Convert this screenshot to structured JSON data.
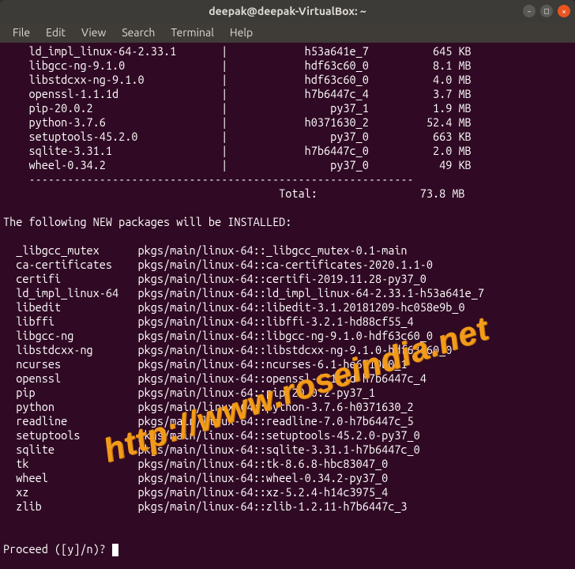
{
  "window": {
    "title": "deepak@deepak-VirtualBox: ~"
  },
  "menu": {
    "file": "File",
    "edit": "Edit",
    "view": "View",
    "search": "Search",
    "terminal": "Terminal",
    "help": "Help"
  },
  "dl_table": {
    "rows": [
      {
        "name": "ld_impl_linux-64-2.33.1",
        "build": "h53a641e_7",
        "size": "645 KB"
      },
      {
        "name": "libgcc-ng-9.1.0",
        "build": "hdf63c60_0",
        "size": "8.1 MB"
      },
      {
        "name": "libstdcxx-ng-9.1.0",
        "build": "hdf63c60_0",
        "size": "4.0 MB"
      },
      {
        "name": "openssl-1.1.1d",
        "build": "h7b6447c_4",
        "size": "3.7 MB"
      },
      {
        "name": "pip-20.0.2",
        "build": "py37_1",
        "size": "1.9 MB"
      },
      {
        "name": "python-3.7.6",
        "build": "h0371630_2",
        "size": "52.4 MB"
      },
      {
        "name": "setuptools-45.2.0",
        "build": "py37_0",
        "size": "663 KB"
      },
      {
        "name": "sqlite-3.31.1",
        "build": "h7b6447c_0",
        "size": "2.0 MB"
      },
      {
        "name": "wheel-0.34.2",
        "build": "py37_0",
        "size": "49 KB"
      }
    ],
    "sep": "    ------------------------------------------------------------",
    "total_label": "Total:",
    "total_value": "73.8 MB"
  },
  "install": {
    "heading": "The following NEW packages will be INSTALLED:",
    "rows": [
      {
        "name": "_libgcc_mutex",
        "spec": "pkgs/main/linux-64::_libgcc_mutex-0.1-main"
      },
      {
        "name": "ca-certificates",
        "spec": "pkgs/main/linux-64::ca-certificates-2020.1.1-0"
      },
      {
        "name": "certifi",
        "spec": "pkgs/main/linux-64::certifi-2019.11.28-py37_0"
      },
      {
        "name": "ld_impl_linux-64",
        "spec": "pkgs/main/linux-64::ld_impl_linux-64-2.33.1-h53a641e_7"
      },
      {
        "name": "libedit",
        "spec": "pkgs/main/linux-64::libedit-3.1.20181209-hc058e9b_0"
      },
      {
        "name": "libffi",
        "spec": "pkgs/main/linux-64::libffi-3.2.1-hd88cf55_4"
      },
      {
        "name": "libgcc-ng",
        "spec": "pkgs/main/linux-64::libgcc-ng-9.1.0-hdf63c60_0"
      },
      {
        "name": "libstdcxx-ng",
        "spec": "pkgs/main/linux-64::libstdcxx-ng-9.1.0-hdf63c60_0"
      },
      {
        "name": "ncurses",
        "spec": "pkgs/main/linux-64::ncurses-6.1-he6710b0_1"
      },
      {
        "name": "openssl",
        "spec": "pkgs/main/linux-64::openssl-1.1.1d-h7b6447c_4"
      },
      {
        "name": "pip",
        "spec": "pkgs/main/linux-64::pip-20.0.2-py37_1"
      },
      {
        "name": "python",
        "spec": "pkgs/main/linux-64::python-3.7.6-h0371630_2"
      },
      {
        "name": "readline",
        "spec": "pkgs/main/linux-64::readline-7.0-h7b6447c_5"
      },
      {
        "name": "setuptools",
        "spec": "pkgs/main/linux-64::setuptools-45.2.0-py37_0"
      },
      {
        "name": "sqlite",
        "spec": "pkgs/main/linux-64::sqlite-3.31.1-h7b6447c_0"
      },
      {
        "name": "tk",
        "spec": "pkgs/main/linux-64::tk-8.6.8-hbc83047_0"
      },
      {
        "name": "wheel",
        "spec": "pkgs/main/linux-64::wheel-0.34.2-py37_0"
      },
      {
        "name": "xz",
        "spec": "pkgs/main/linux-64::xz-5.2.4-h14c3975_4"
      },
      {
        "name": "zlib",
        "spec": "pkgs/main/linux-64::zlib-1.2.11-h7b6447c_3"
      }
    ]
  },
  "prompt": "Proceed ([y]/n)? ",
  "watermark": "http://www.roseindia.net"
}
